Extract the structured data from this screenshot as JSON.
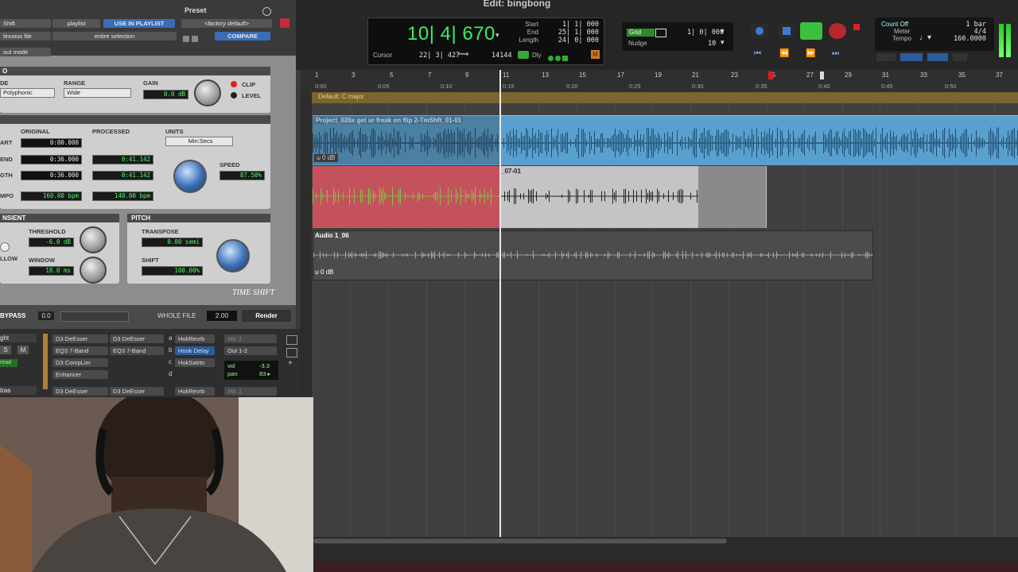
{
  "window": {
    "title": "Edit: bingbong"
  },
  "plugin": {
    "shift_label": "Shift",
    "playlist_label": "playlist",
    "use_in_playlist": "USE IN PLAYLIST",
    "continuous_file": "tinuous file",
    "entire_selection": "entire selection",
    "out_mode": "out mode",
    "preset_label": "Preset",
    "preset_value": "<factory default>",
    "compare": "COMPARE",
    "audio_section": "O",
    "mode_label": "DE",
    "mode_value": "Polyphonic",
    "range_label": "RANGE",
    "range_value": "Wide",
    "gain_label": "GAIN",
    "gain_value": "0.0 dB",
    "clip_label": "CLIP",
    "level_label": "LEVEL",
    "original_label": "ORIGINAL",
    "processed_label": "PROCESSED",
    "units_label": "UNITS",
    "units_value": "Min:Secs",
    "start_label": "ART",
    "end_label": "END",
    "length_label": "GTH",
    "tempo_label": "MPO",
    "orig_start": "0:00.000",
    "orig_end": "0:36.000",
    "orig_length": "0:36.000",
    "orig_tempo": "160.00 bpm",
    "proc_start": "0:41.142",
    "proc_length": "0:41.142",
    "proc_tempo": "140.00 bpm",
    "speed_label": "SPEED",
    "speed_value": "87.50%",
    "transient_label": "NSIENT",
    "threshold_label": "THRESHOLD",
    "threshold_value": "-6.0 dB",
    "window_label": "WINDOW",
    "window_value": "18.0 ms",
    "follow_label": "LLOW",
    "pitch_label": "PITCH",
    "transpose_label": "TRANSPOSE",
    "transpose_value": "0.00 semi",
    "shift_pitch_label": "SHIFT",
    "shift_value": "100.00%",
    "brand": "TIME SHIFT",
    "bypass_label": "BYPASS",
    "bypass_value": "0.0",
    "whole_file": "WHOLE FILE",
    "whole_file_value": "2.00",
    "render": "Render"
  },
  "mixer": {
    "track1_name": "ght",
    "track2_name": "tras",
    "solo": "S",
    "mute": "M",
    "read": "read",
    "col1": [
      "D3 DeEsser",
      "EQ3 7-Band",
      "D3 CompLim",
      "Enhancer"
    ],
    "col2": [
      "D3 DeEsser",
      "EQ3 7-Band"
    ],
    "col3_letters": [
      "a",
      "b",
      "c",
      "d"
    ],
    "col3": [
      "HokRevrb",
      "Hook Delay",
      "HokSatrtn"
    ],
    "col4": [
      "Mic 1",
      "Out 1-2"
    ],
    "vol_label": "vol",
    "vol_value": "-3.3",
    "pan_label": "pan",
    "pan_value": "83 ▸",
    "row2": [
      "D3 DeEsser",
      "D3 DeEsser",
      "HokRevrb",
      "Mic 1"
    ]
  },
  "transport": {
    "counter": "10| 4| 670",
    "start_label": "Start",
    "end_label": "End",
    "length_label": "Length",
    "start": "1| 1| 000",
    "end": "25| 1| 000",
    "length": "24| 0| 000",
    "cursor_label": "Cursor",
    "cursor_value": "22| 3| 427",
    "cursor_num": "14144",
    "dly": "Dly",
    "grid_label": "Grid",
    "grid_value": "1| 0| 000",
    "nudge_label": "Nudge",
    "nudge_value": "10",
    "count_off": "Count Off",
    "meter_label": "Meter",
    "tempo_label": "Tempo",
    "bars": "1 bar",
    "meter_value": "4/4",
    "tempo_value": "160.0000"
  },
  "ruler": {
    "bars": [
      "1",
      "3",
      "5",
      "7",
      "9",
      "11",
      "13",
      "15",
      "17",
      "19",
      "21",
      "23",
      "25",
      "27",
      "29",
      "31",
      "33",
      "35",
      "37"
    ],
    "times": [
      "0:00",
      "0:05",
      "0:10",
      "0:15",
      "0:20",
      "0:25",
      "0:30",
      "0:35",
      "0:40",
      "0:45",
      "0:50"
    ],
    "key": "Default: C major"
  },
  "tracks": {
    "clip1_name": "Project_026x get ur freak on flip 2-TmShft_01-01",
    "clip1_gain": "0 dB",
    "clip2_name": "_07-01",
    "clip3_name": "Audio 1_06",
    "clip3_gain": "0 dB"
  },
  "colors": {
    "clip_blue": "#5aa0cf",
    "clip_red": "#c4525c",
    "clip_grey": "#c4c4c4",
    "accent_green": "#3cf060"
  }
}
